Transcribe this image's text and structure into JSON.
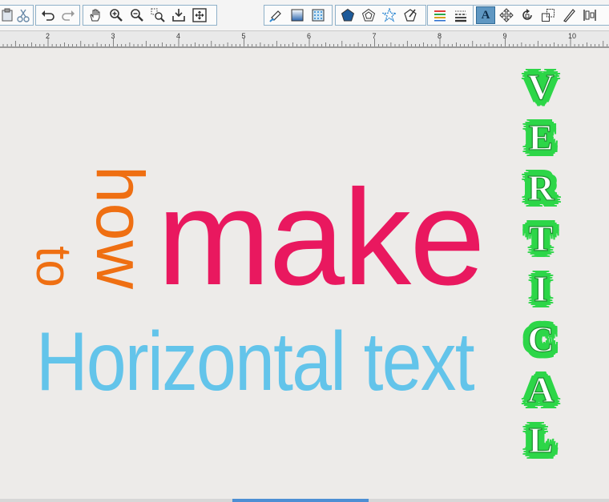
{
  "toolbar": {
    "groups": [
      {
        "name": "clipboard",
        "items": [
          "paste-icon",
          "cut-icon"
        ]
      },
      {
        "name": "history",
        "items": [
          "undo-icon",
          "redo-icon"
        ]
      },
      {
        "name": "view",
        "items": [
          "pan-hand-icon",
          "zoom-in-icon",
          "zoom-out-icon",
          "zoom-selection-icon",
          "zoom-page-icon",
          "fit-to-window-icon"
        ]
      },
      {
        "name": "style",
        "items": [
          "line-color-icon",
          "fill-gradient-icon",
          "fill-pattern-icon",
          "polygon-icon",
          "nested-polygon-icon",
          "star-icon",
          "edit-points-icon",
          "line-style-icon",
          "line-dash-icon",
          "text-tool-icon",
          "move-icon",
          "rotate-icon",
          "replicate-icon",
          "knife-icon",
          "align-icon"
        ]
      }
    ],
    "text_tool_glyph": "A",
    "active_tool": "text-tool-icon"
  },
  "ruler": {
    "labels": [
      "2",
      "3",
      "4",
      "5",
      "6",
      "7",
      "8",
      "9",
      "10"
    ]
  },
  "canvas": {
    "words": {
      "to": "to",
      "how": "how",
      "make": "make",
      "horizontal": "Horizontal text",
      "vertical": [
        "V",
        "E",
        "R",
        "T",
        "I",
        "C",
        "A",
        "L"
      ]
    },
    "colors": {
      "orange": "#ef6f12",
      "pink": "#e9185f",
      "blue": "#63c4ea",
      "green": "#2dd648",
      "background": "#edebe9"
    }
  }
}
